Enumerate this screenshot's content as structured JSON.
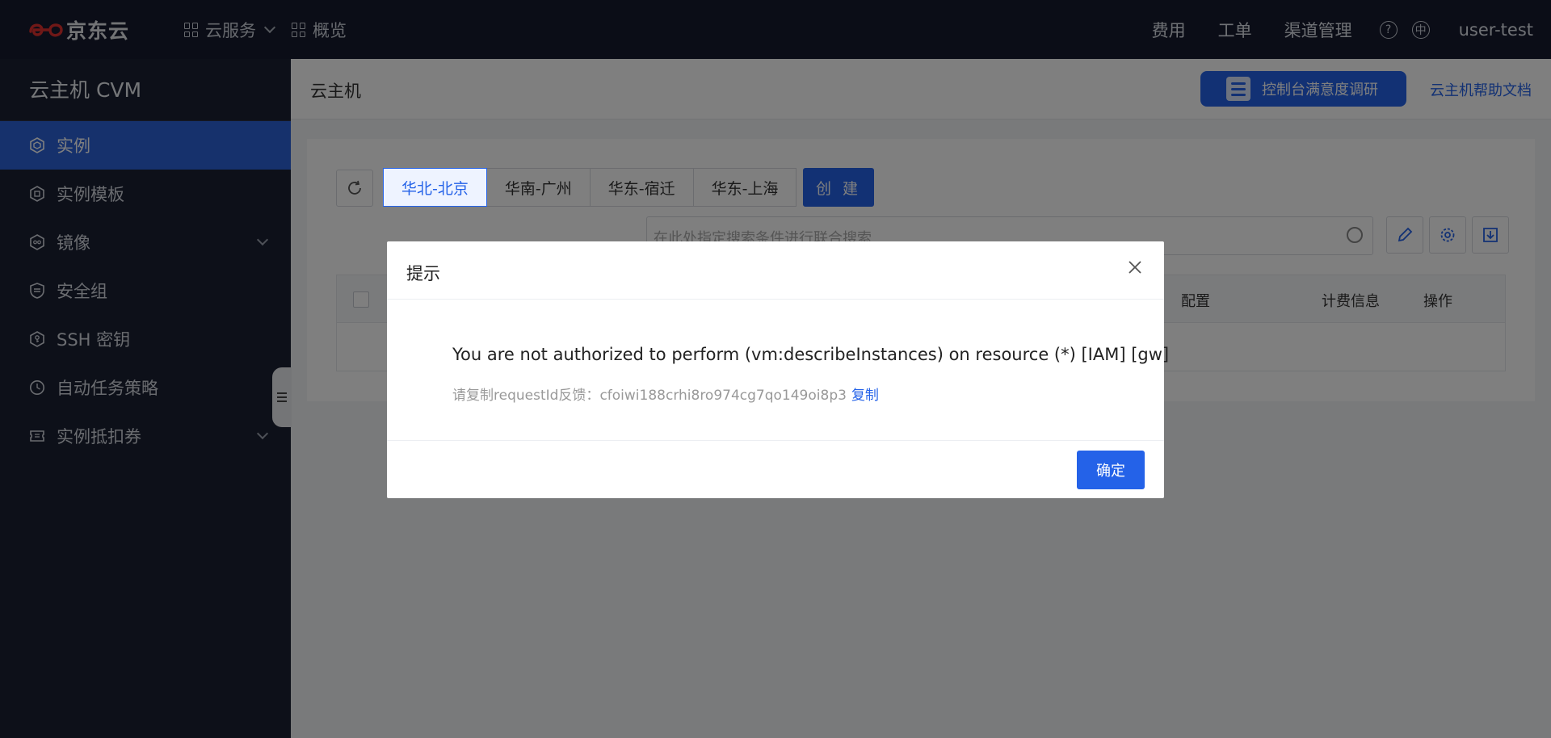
{
  "brand": {
    "name": "京东云",
    "accent": "#2462e8",
    "logo_color": "#e0312f"
  },
  "topnav": {
    "cloud_services": "云服务",
    "overview": "概览",
    "fees": "费用",
    "tickets": "工单",
    "channel": "渠道管理",
    "user": "user-test"
  },
  "sidebar": {
    "title": "云主机 CVM",
    "items": [
      {
        "label": "实例",
        "icon": "hexagon-icon",
        "active": true
      },
      {
        "label": "实例模板",
        "icon": "template-icon"
      },
      {
        "label": "镜像",
        "icon": "image-icon",
        "expandable": true
      },
      {
        "label": "安全组",
        "icon": "shield-icon"
      },
      {
        "label": "SSH 密钥",
        "icon": "key-icon"
      },
      {
        "label": "自动任务策略",
        "icon": "clock-icon"
      },
      {
        "label": "实例抵扣券",
        "icon": "coupon-icon",
        "expandable": true
      }
    ]
  },
  "content": {
    "page_title": "云主机",
    "survey_label": "控制台满意度调研",
    "help_doc": "云主机帮助文档",
    "regions": [
      "华北-北京",
      "华南-广州",
      "华东-宿迁",
      "华东-上海"
    ],
    "create_label": "创 建",
    "search_placeholder": "在此处指定搜索条件进行联合搜索",
    "columns": {
      "config": "配置",
      "billing": "计费信息",
      "actions": "操作"
    }
  },
  "modal": {
    "title": "提示",
    "message": "You are not authorized to perform (vm:describeInstances) on resource (*) [IAM] [gw]",
    "request_prefix": "请复制requestId反馈：",
    "request_id": "cfoiwi188crhi8ro974cg7qo149oi8p3",
    "copy_label": "复制",
    "ok_label": "确定"
  }
}
